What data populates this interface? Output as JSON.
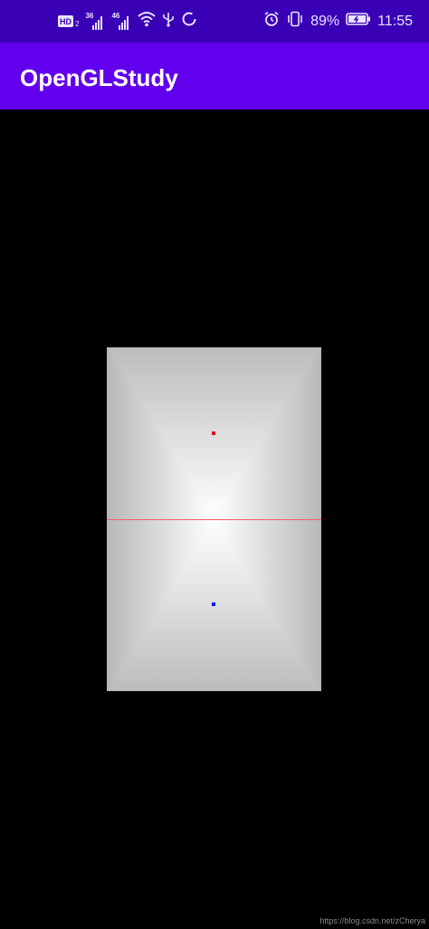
{
  "status_bar": {
    "hd_label": "HD",
    "hd_sub": "2",
    "network_1": "36",
    "network_2": "46",
    "battery": "89%",
    "time": "11:55",
    "icons": [
      "hd-icon",
      "signal-icon",
      "signal-icon",
      "wifi-icon",
      "usb-icon",
      "sync-icon",
      "alarm-icon",
      "vibrate-icon",
      "battery-icon"
    ]
  },
  "app_bar": {
    "title": "OpenGLStudy",
    "color": "#6200ee"
  },
  "gl_view": {
    "description_colors": {
      "center": "#ffffff",
      "edge": "#bdbdbd",
      "line": "#ff5a5a",
      "top_point": "#e0001a",
      "bottom_point": "#0018e0"
    }
  },
  "watermark": "https://blog.csdn.net/zCherya"
}
